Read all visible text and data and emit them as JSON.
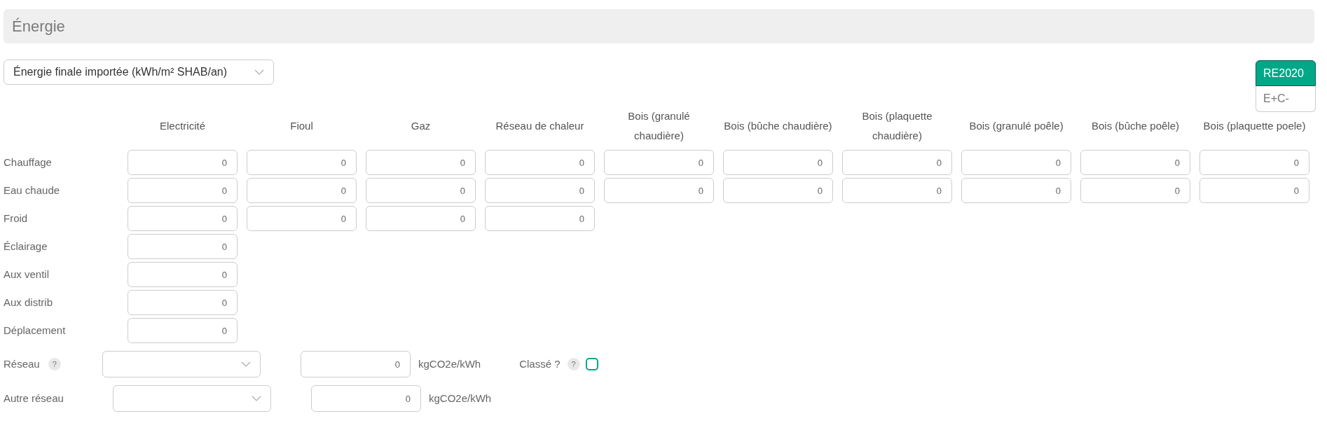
{
  "section_title": "Énergie",
  "unit_select": {
    "value": "Énergie finale importée (kWh/m² SHAB/an)"
  },
  "standard_toggle": [
    {
      "label": "RE2020",
      "selected": true
    },
    {
      "label": "E+C-",
      "selected": false
    }
  ],
  "table": {
    "columns": [
      "Electricité",
      "Fioul",
      "Gaz",
      "Réseau de chaleur",
      "Bois (granulé chaudière)",
      "Bois (bûche chaudière)",
      "Bois (plaquette chaudière)",
      "Bois (granulé poêle)",
      "Bois (bûche poêle)",
      "Bois (plaquette poele)"
    ],
    "rows": [
      {
        "label": "Chauffage",
        "values": [
          "0",
          "0",
          "0",
          "0",
          "0",
          "0",
          "0",
          "0",
          "0",
          "0"
        ]
      },
      {
        "label": "Eau chaude",
        "values": [
          "0",
          "0",
          "0",
          "0",
          "0",
          "0",
          "0",
          "0",
          "0",
          "0"
        ]
      },
      {
        "label": "Froid",
        "values": [
          "0",
          "0",
          "0",
          "0"
        ]
      },
      {
        "label": "Éclairage",
        "values": [
          "0"
        ]
      },
      {
        "label": "Aux ventil",
        "values": [
          "0"
        ]
      },
      {
        "label": "Aux distrib",
        "values": [
          "0"
        ]
      },
      {
        "label": "Déplacement",
        "values": [
          "0"
        ]
      }
    ]
  },
  "networks": [
    {
      "label": "Réseau",
      "help": "?",
      "value": "0",
      "unit": "kgCO2e/kWh",
      "classed": {
        "label": "Classé ?",
        "help": "?",
        "checked": false
      }
    },
    {
      "label": "Autre réseau",
      "value": "0",
      "unit": "kgCO2e/kWh"
    }
  ]
}
